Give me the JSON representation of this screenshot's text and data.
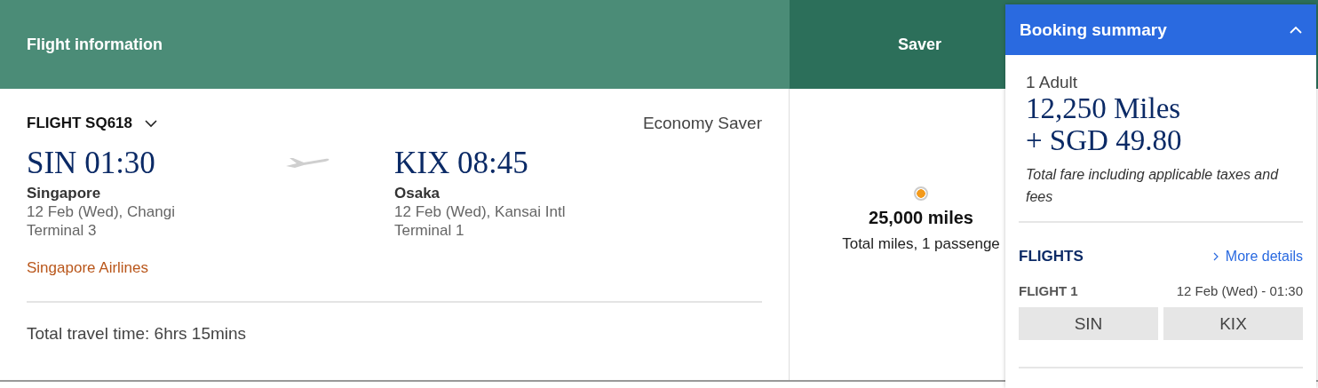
{
  "header": {
    "flight_information": "Flight information",
    "fare_column": "Saver"
  },
  "flight": {
    "number": "FLIGHT SQ618",
    "expanded": false,
    "cabin": "Economy Saver",
    "departure": {
      "code_time": "SIN 01:30",
      "city": "Singapore",
      "date_airport": "12 Feb (Wed), Changi",
      "terminal": "Terminal 3"
    },
    "arrival": {
      "code_time": "KIX 08:45",
      "city": "Osaka",
      "date_airport": "12 Feb (Wed), Kansai Intl",
      "terminal": "Terminal 1"
    },
    "airline": "Singapore Airlines",
    "travel_time": "Total travel time: 6hrs 15mins"
  },
  "fare_option": {
    "selected": true,
    "miles": "25,000 miles",
    "note": "Total miles, 1 passenge"
  },
  "booking_summary": {
    "title": "Booking summary",
    "expanded": true,
    "passengers": "1 Adult",
    "miles": "12,250 Miles",
    "cash": "+ SGD 49.80",
    "fare_note": "Total fare including applicable taxes and fees",
    "flights_heading": "FLIGHTS",
    "more_details": "More details",
    "flights": [
      {
        "label": "FLIGHT 1",
        "date_time": "12 Feb (Wed) - 01:30",
        "origin": "SIN",
        "destination": "KIX"
      }
    ]
  }
}
